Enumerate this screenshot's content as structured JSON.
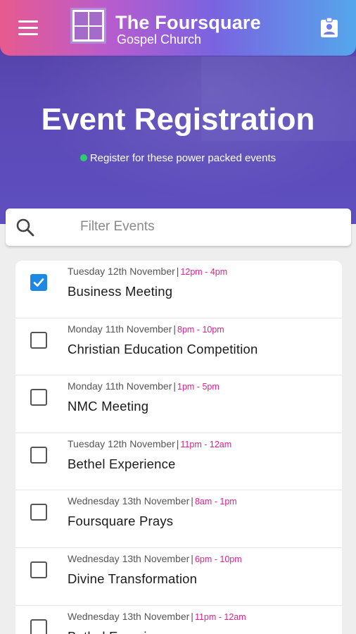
{
  "app": {
    "title_line1": "The Foursquare",
    "title_line2": "Gospel Church"
  },
  "colors": {
    "accent": "#1e88e5",
    "time_text": "#e0218a",
    "online_dot": "#2ecc71",
    "hero_bg": "#5b49b5"
  },
  "icons": {
    "menu": "hamburger-menu-icon",
    "profile": "contact-badge-icon",
    "search": "search-icon",
    "checked": "checkbox-checked-icon"
  },
  "hero": {
    "title": "Event Registration",
    "subtitle": "Register for these power packed events"
  },
  "search": {
    "placeholder": "Filter Events",
    "value": ""
  },
  "events": [
    {
      "date": "Tuesday 12th November",
      "time": "12pm - 4pm",
      "title": "Business Meeting",
      "checked": true
    },
    {
      "date": "Monday 11th November",
      "time": "8pm - 10pm",
      "title": "Christian Education Competition",
      "checked": false
    },
    {
      "date": "Monday 11th November",
      "time": "1pm - 5pm",
      "title": "NMC Meeting",
      "checked": false
    },
    {
      "date": "Tuesday 12th November",
      "time": "11pm - 12am",
      "title": "Bethel Experience",
      "checked": false
    },
    {
      "date": "Wednesday 13th November",
      "time": "8am - 1pm",
      "title": "Foursquare Prays",
      "checked": false
    },
    {
      "date": "Wednesday 13th November",
      "time": "6pm - 10pm",
      "title": "Divine Transformation",
      "checked": false
    },
    {
      "date": "Wednesday 13th November",
      "time": "11pm - 12am",
      "title": "Bethel Experience",
      "checked": false
    }
  ]
}
